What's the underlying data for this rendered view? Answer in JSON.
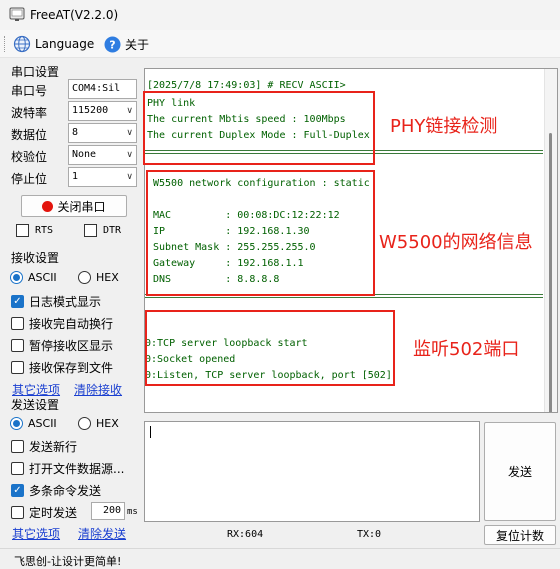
{
  "window": {
    "title": "FreeAT(V2.2.0)"
  },
  "menu": {
    "language_label": "Language",
    "about_label": "关于"
  },
  "serial": {
    "group_title": "串口设置",
    "port_label": "串口号",
    "port_value": "COM4:Sil",
    "baud_label": "波特率",
    "baud_value": "115200",
    "databits_label": "数据位",
    "databits_value": "8",
    "parity_label": "校验位",
    "parity_value": "None",
    "stopbits_label": "停止位",
    "stopbits_value": "1",
    "close_port_label": "关闭串口",
    "rts_label": "RTS",
    "dtr_label": "DTR"
  },
  "receive": {
    "group_title": "接收设置",
    "ascii_label": "ASCII",
    "hex_label": "HEX",
    "log_mode_label": "日志模式显示",
    "auto_newline_label": "接收完自动换行",
    "pause_label": "暂停接收区显示",
    "save_to_file_label": "接收保存到文件",
    "more_options_label": "其它选项",
    "clear_receive_label": "清除接收"
  },
  "send": {
    "group_title": "发送设置",
    "ascii_label": "ASCII",
    "hex_label": "HEX",
    "send_newline_label": "发送新行",
    "open_file_label": "打开文件数据源...",
    "multi_command_label": "多条命令发送",
    "timed_send_label": "定时发送",
    "interval_value": "200",
    "interval_unit": "ms",
    "more_options_label": "其它选项",
    "clear_send_label": "清除发送",
    "send_button_label": "发送",
    "reset_count_label": "复位计数"
  },
  "receive_log": {
    "header_line": "[2025/7/8 17:49:03] # RECV ASCII>",
    "phy_lines": [
      "PHY link",
      "The current Mbtis speed : 100Mbps",
      "The current Duplex Mode : Full-Duplex"
    ],
    "net_lines": [
      "W5500 network configuration : static",
      "",
      "MAC         : 00:08:DC:12:22:12",
      "IP          : 192.168.1.30",
      "Subnet Mask : 255.255.255.0",
      "Gateway     : 192.168.1.1",
      "DNS         : 8.8.8.8"
    ],
    "socket_lines": [
      "0:TCP server loopback start",
      "0:Socket opened",
      "0:Listen, TCP server loopback, port [502]"
    ]
  },
  "annotations": {
    "phy": "PHY链接检测",
    "network": "W5500的网络信息",
    "listen": "监听502端口",
    "color": "#e8231a"
  },
  "counters": {
    "rx": "RX:604",
    "tx": "TX:0"
  },
  "statusbar": {
    "slogan": "飞思创-让设计更简单!"
  },
  "colors": {
    "accent": "#1a73c9",
    "log_text": "#006000",
    "link": "#1a3fd0"
  }
}
